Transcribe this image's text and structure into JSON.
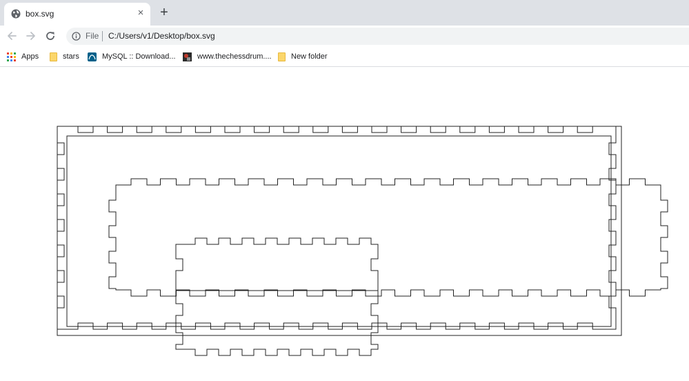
{
  "tab": {
    "title": "box.svg",
    "favicon": "globe-icon",
    "close_glyph": "×"
  },
  "new_tab_glyph": "+",
  "toolbar": {
    "back_icon": "arrow-left-icon",
    "forward_icon": "arrow-right-icon",
    "reload_icon": "reload-icon",
    "scheme": "File",
    "url": "C:/Users/v1/Desktop/box.svg"
  },
  "bookmarks": [
    {
      "label": "Apps",
      "icon": "apps-grid-icon"
    },
    {
      "label": "stars",
      "icon": "folder-icon"
    },
    {
      "label": "MySQL :: Download...",
      "icon": "mysql-icon"
    },
    {
      "label": "www.thechessdrum....",
      "icon": "chessdrum-icon"
    },
    {
      "label": "New folder",
      "icon": "folder-icon"
    }
  ],
  "colors": {
    "tabstrip": "#dee1e6",
    "omnibox": "#f1f3f4",
    "stroke": "#202020"
  }
}
